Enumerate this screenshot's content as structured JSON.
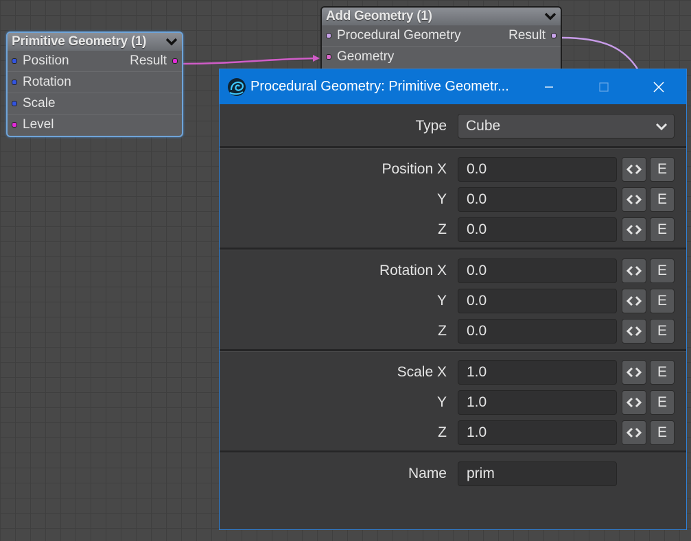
{
  "colors": {
    "canvas_bg": "#484848",
    "titlebar_blue": "#0b74d6",
    "selected_node_border": "#6fa4d8",
    "wire_magenta": "#d05cc8",
    "wire_lavender": "#c79be8"
  },
  "node_primitive": {
    "title": "Primitive Geometry (1)",
    "output_label": "Result",
    "inputs": [
      {
        "label": "Position",
        "port_color": "blue"
      },
      {
        "label": "Rotation",
        "port_color": "blue"
      },
      {
        "label": "Scale",
        "port_color": "blue"
      },
      {
        "label": "Level",
        "port_color": "magenta"
      }
    ]
  },
  "node_add": {
    "title": "Add Geometry (1)",
    "inputs": [
      {
        "label": "Procedural Geometry",
        "port_color": "lavender"
      },
      {
        "label": "Geometry",
        "port_color": "pink"
      }
    ],
    "output_label": "Result"
  },
  "dialog": {
    "title": "Procedural Geometry: Primitive Geometr...",
    "icons": {
      "app": "lightwave-app-icon",
      "minimize": "minimize-icon",
      "maximize": "maximize-icon",
      "close": "close-icon"
    },
    "type_label": "Type",
    "type_value": "Cube",
    "position": {
      "label": "Position X",
      "y_label": "Y",
      "z_label": "Z",
      "x": "0.0",
      "y": "0.0",
      "z": "0.0"
    },
    "rotation": {
      "label": "Rotation X",
      "y_label": "Y",
      "z_label": "Z",
      "x": "0.0",
      "y": "0.0",
      "z": "0.0"
    },
    "scale": {
      "label": "Scale X",
      "y_label": "Y",
      "z_label": "Z",
      "x": "1.0",
      "y": "1.0",
      "z": "1.0"
    },
    "envelope_button_icon": "envelope-icon",
    "e_button_label": "E",
    "name_label": "Name",
    "name_value": "prim"
  }
}
